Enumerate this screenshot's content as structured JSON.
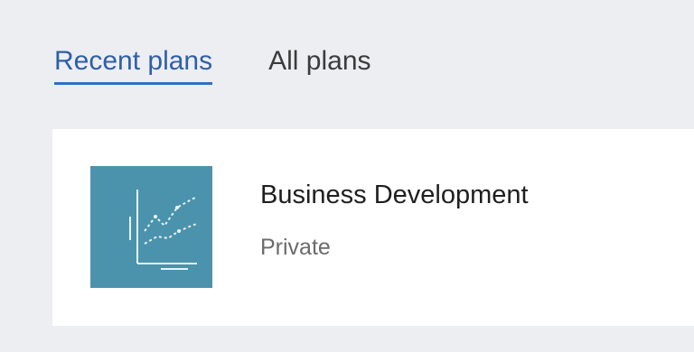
{
  "tabs": [
    {
      "label": "Recent plans",
      "active": true
    },
    {
      "label": "All plans",
      "active": false
    }
  ],
  "plan_card": {
    "title": "Business Development",
    "visibility": "Private",
    "icon": "chart-trend-icon",
    "icon_bg_color": "#4b93ad"
  },
  "colors": {
    "accent": "#2f6fc2",
    "background": "#edeef2",
    "card": "#ffffff"
  }
}
